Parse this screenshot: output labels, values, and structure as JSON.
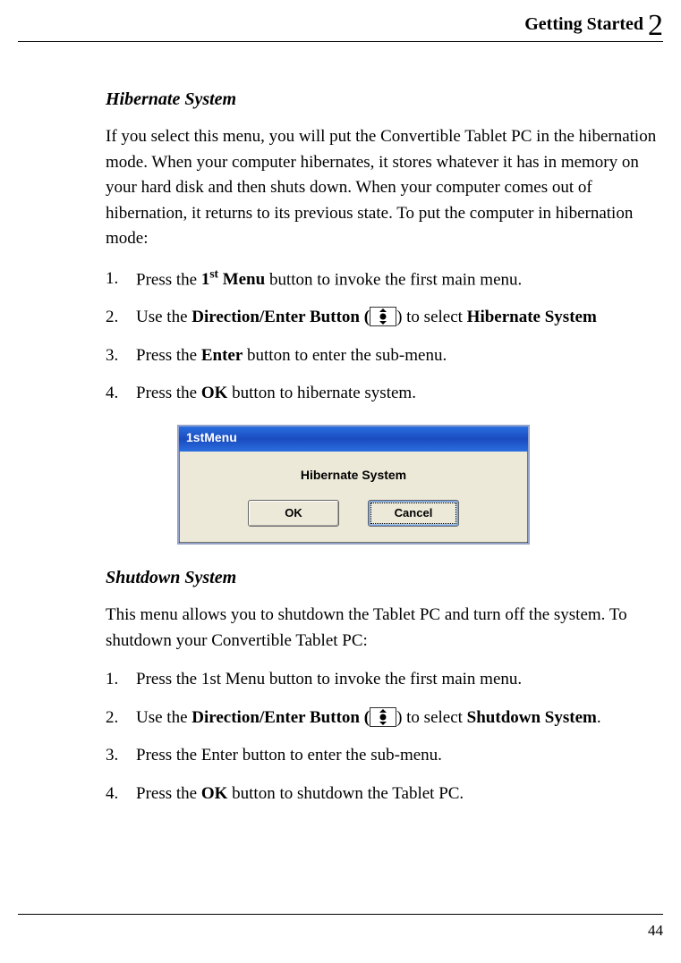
{
  "header": {
    "section": "Getting Started",
    "chapter": "2"
  },
  "section1": {
    "title": "Hibernate System",
    "intro": "If you select this menu, you will put the Convertible Tablet PC in the hibernation mode. When your computer hibernates, it stores whatever it has in memory on your hard disk and then shuts down. When your computer comes out of hibernation, it returns to its previous state. To put the computer in hibernation mode:",
    "steps": {
      "s1_pre": "Press the ",
      "s1_bold_a": "1",
      "s1_bold_sup": "st",
      "s1_bold_b": " Menu",
      "s1_post": " button to invoke the first main menu.",
      "s2_pre": "Use the ",
      "s2_bold": "Direction/Enter Button (",
      "s2_mid": ") to select ",
      "s2_bold2": "Hibernate System",
      "s3_pre": "Press the ",
      "s3_bold": "Enter",
      "s3_post": " button to enter the sub-menu.",
      "s4_pre": "Press the ",
      "s4_bold": "OK",
      "s4_post": " button to hibernate system."
    },
    "dialog": {
      "title": "1stMenu",
      "message": "Hibernate System",
      "ok": "OK",
      "cancel": "Cancel"
    }
  },
  "section2": {
    "title": "Shutdown System",
    "intro": "This menu allows you to shutdown the Tablet PC and turn off the system. To shutdown your Convertible Tablet PC:",
    "steps": {
      "s1": "Press the 1st Menu button to invoke the first main menu.",
      "s2_pre": "Use the ",
      "s2_bold": "Direction/Enter Button (",
      "s2_mid": ") to select ",
      "s2_bold2": "Shutdown System",
      "s2_post": ".",
      "s3": "Press the Enter button to enter the sub-menu.",
      "s4_pre": "Press the ",
      "s4_bold": "OK",
      "s4_post": " button to shutdown the Tablet PC."
    }
  },
  "footer": {
    "page": "44"
  }
}
